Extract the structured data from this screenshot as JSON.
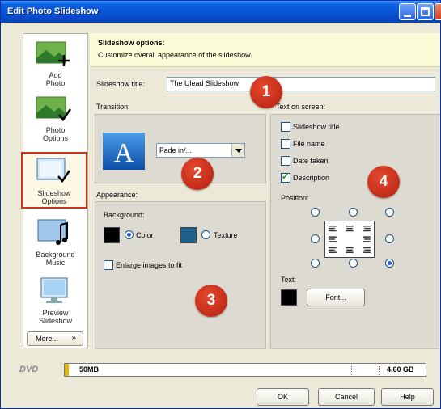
{
  "window": {
    "title": "Edit Photo Slideshow"
  },
  "sidebar": {
    "items": [
      {
        "label_line1": "Add",
        "label_line2": "Photo",
        "icon": "add-photo-icon"
      },
      {
        "label_line1": "Photo",
        "label_line2": "Options",
        "icon": "photo-options-icon"
      },
      {
        "label_line1": "Slideshow",
        "label_line2": "Options",
        "icon": "slideshow-options-icon",
        "selected": true
      },
      {
        "label_line1": "Background",
        "label_line2": "Music",
        "icon": "music-note-icon"
      },
      {
        "label_line1": "Preview",
        "label_line2": "Slideshow",
        "icon": "monitor-icon"
      }
    ],
    "more_label": "More...",
    "more_icon": "chevron-double-down-icon"
  },
  "header": {
    "title": "Slideshow options:",
    "subtitle": "Customize overall appearance of the slideshow."
  },
  "slideshow_title": {
    "label": "Slideshow title:",
    "value": "The Ulead Slideshow"
  },
  "transition": {
    "label": "Transition:",
    "selected": "Fade in/..."
  },
  "appearance": {
    "label": "Appearance:",
    "background_label": "Background:",
    "color_label": "Color",
    "texture_label": "Texture",
    "background_choice": "Color",
    "enlarge_label": "Enlarge images to fit",
    "enlarge_checked": false
  },
  "text_on_screen": {
    "label": "Text on screen:",
    "options": [
      {
        "label": "Slideshow title",
        "checked": false
      },
      {
        "label": "File name",
        "checked": false
      },
      {
        "label": "Date taken",
        "checked": false
      },
      {
        "label": "Description",
        "checked": true
      }
    ],
    "position_label": "Position:",
    "position_selected": "bottom-right",
    "text_label": "Text:",
    "font_button": "Font..."
  },
  "badges": [
    "1",
    "2",
    "3",
    "4"
  ],
  "disc": {
    "type": "DVD",
    "used": "50MB",
    "capacity": "4.60 GB",
    "used_fraction": 0.011
  },
  "buttons": {
    "ok": "OK",
    "cancel": "Cancel",
    "help": "Help"
  },
  "colors": {
    "titlebar": "#0a52d4",
    "badge": "#c8331f",
    "text_color_swatch": "#000000",
    "bg_color_swatch": "#000000",
    "texture_swatch": "#1f5f8c",
    "disc_bar": "#e6b800"
  }
}
